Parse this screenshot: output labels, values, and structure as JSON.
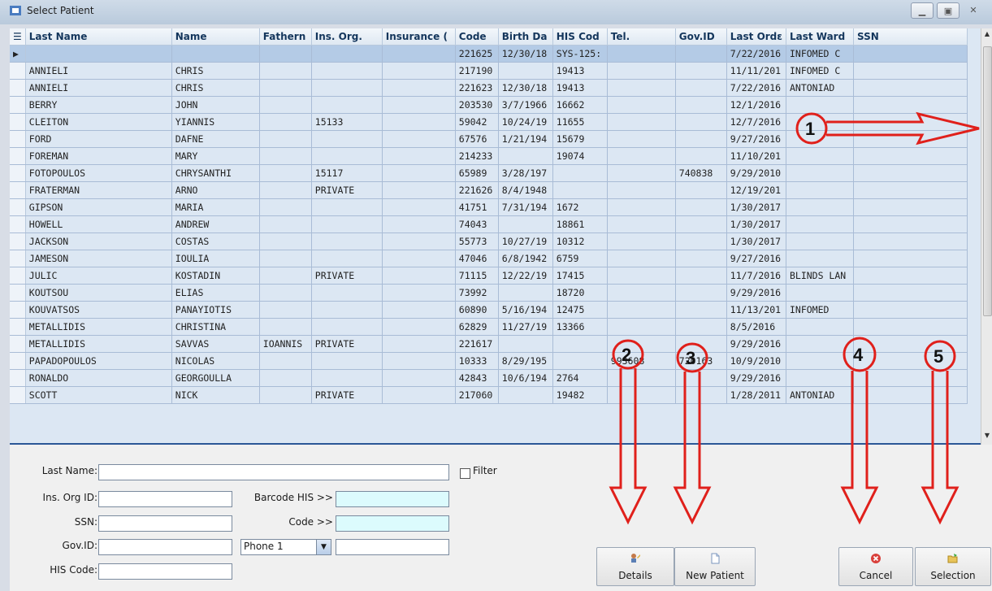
{
  "window": {
    "title": "Select Patient"
  },
  "grid": {
    "columns": [
      "Last Name",
      "Name",
      "Fathern",
      "Ins. Org.",
      "Insurance (",
      "Code",
      "Birth Da",
      "HIS Cod",
      "Tel.",
      "Gov.ID",
      "Last Ordε",
      "Last Ward",
      "SSN"
    ],
    "rows": [
      [
        "",
        "",
        "",
        "",
        "",
        "221625",
        "12/30/18",
        "SYS-125:",
        "",
        "",
        "7/22/2016",
        "INFOMED C",
        ""
      ],
      [
        "ANNIELI",
        "CHRIS",
        "",
        "",
        "",
        "217190",
        "",
        "19413",
        "",
        "",
        "11/11/201",
        "INFOMED C",
        ""
      ],
      [
        "ANNIELI",
        "CHRIS",
        "",
        "",
        "",
        "221623",
        "12/30/18",
        "19413",
        "",
        "",
        "7/22/2016",
        "ANTONIAD",
        ""
      ],
      [
        "BERRY",
        "JOHN",
        "",
        "",
        "",
        "203530",
        "3/7/1966",
        "16662",
        "",
        "",
        "12/1/2016",
        "",
        ""
      ],
      [
        "CLEITON",
        "YIANNIS",
        "",
        "15133",
        "",
        "59042",
        "10/24/19",
        "11655",
        "",
        "",
        "12/7/2016",
        "",
        ""
      ],
      [
        "FORD",
        "DAFNE",
        "",
        "",
        "",
        "67576",
        "1/21/194",
        "15679",
        "",
        "",
        "9/27/2016",
        "",
        ""
      ],
      [
        "FOREMAN",
        "MARY",
        "",
        "",
        "",
        "214233",
        "",
        "19074",
        "",
        "",
        "11/10/201",
        "",
        ""
      ],
      [
        "FOTOPOULOS",
        "CHRYSANTHI",
        "",
        "15117",
        "",
        "65989",
        "3/28/197",
        "",
        "",
        "740838",
        "9/29/2010",
        "",
        ""
      ],
      [
        "FRATERMAN",
        "ARNO",
        "",
        "PRIVATE",
        "",
        "221626",
        "8/4/1948",
        "",
        "",
        "",
        "12/19/201",
        "",
        ""
      ],
      [
        "GIPSON",
        "MARIA",
        "",
        "",
        "",
        "41751",
        "7/31/194",
        "1672",
        "",
        "",
        "1/30/2017",
        "",
        ""
      ],
      [
        "HOWELL",
        "ANDREW",
        "",
        "",
        "",
        "74043",
        "",
        "18861",
        "",
        "",
        "1/30/2017",
        "",
        ""
      ],
      [
        "JACKSON",
        "COSTAS",
        "",
        "",
        "",
        "55773",
        "10/27/19",
        "10312",
        "",
        "",
        "1/30/2017",
        "",
        ""
      ],
      [
        "JAMESON",
        "IOULIA",
        "",
        "",
        "",
        "47046",
        "6/8/1942",
        "6759",
        "",
        "",
        "9/27/2016",
        "",
        ""
      ],
      [
        "JULIC",
        "KOSTADIN",
        "",
        "PRIVATE",
        "",
        "71115",
        "12/22/19",
        "17415",
        "",
        "",
        "11/7/2016",
        "BLINDS LAN",
        ""
      ],
      [
        "KOUTSOU",
        "ELIAS",
        "",
        "",
        "",
        "73992",
        "",
        "18720",
        "",
        "",
        "9/29/2016",
        "",
        ""
      ],
      [
        "KOUVATSOS",
        "PANAYIOTIS",
        "",
        "",
        "",
        "60890",
        "5/16/194",
        "12475",
        "",
        "",
        "11/13/201",
        "INFOMED",
        ""
      ],
      [
        "METALLIDIS",
        "CHRISTINA",
        "",
        "",
        "",
        "62829",
        "11/27/19",
        "13366",
        "",
        "",
        "8/5/2016",
        "",
        ""
      ],
      [
        "METALLIDIS",
        "SAVVAS",
        "IOANNIS",
        "PRIVATE",
        "",
        "221617",
        "",
        "",
        "",
        "",
        "9/29/2016",
        "",
        ""
      ],
      [
        "PAPADOPOULOS",
        "NICOLAS",
        "",
        "",
        "",
        "10333",
        "8/29/195",
        "",
        "993608",
        "720163",
        "10/9/2010",
        "",
        ""
      ],
      [
        "RONALDO",
        "GEORGOULLA",
        "",
        "",
        "",
        "42843",
        "10/6/194",
        "2764",
        "",
        "",
        "9/29/2016",
        "",
        ""
      ],
      [
        "SCOTT",
        "NICK",
        "",
        "PRIVATE",
        "",
        "217060",
        "",
        "19482",
        "",
        "",
        "1/28/2011",
        "ANTONIAD",
        ""
      ]
    ]
  },
  "form": {
    "last_name_label": "Last Name:",
    "filter_label": "Filter",
    "ins_org_label": "Ins. Org ID:",
    "barcode_label": "Barcode HIS >>",
    "ssn_label": "SSN:",
    "code_label": "Code >>",
    "gov_label": "Gov.ID:",
    "phone_select": "Phone 1",
    "his_label": "HIS Code:"
  },
  "buttons": {
    "details": "Details",
    "new_patient": "New Patient",
    "cancel": "Cancel",
    "selection": "Selection"
  },
  "annotations": [
    "1",
    "2",
    "3",
    "4",
    "5"
  ],
  "colors": {
    "annotation": "#e0201b",
    "grid_bg": "#dce7f3",
    "selected_row": "#b4cbe6"
  }
}
